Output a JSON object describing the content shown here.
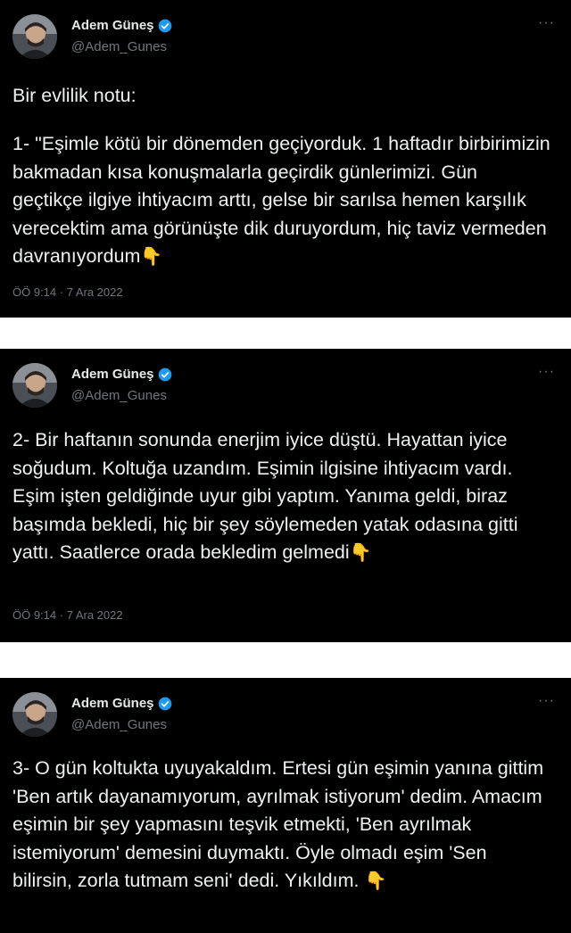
{
  "author": {
    "name": "Adem Güneş",
    "handle": "@Adem_Gunes"
  },
  "icons": {
    "verified": "verified-badge-icon",
    "more": "more-dots-icon",
    "emoji": "backhand-index-pointing-down-emoji"
  },
  "colors": {
    "background": "#000000",
    "text": "#e7e9ea",
    "secondary": "#71767b",
    "verified": "#1d9bf0",
    "emoji": "#f6c244"
  },
  "more_label": "···",
  "emoji_glyph": "👇",
  "tweets": [
    {
      "intro": "Bir evlilik notu:",
      "text": "1- \"Eşimle kötü bir dönemden geçiyorduk. 1 haftadır birbirimizin bakmadan kısa konuşmalarla geçirdik günlerimizi. Gün geçtikçe ilgiye ihtiyacım arttı, gelse bir sarılsa hemen karşılık verecektim ama görünüşte dik duruyordum, hiç taviz vermeden davranıyordum",
      "timestamp": "ÖÖ 9:14 · 7 Ara 2022"
    },
    {
      "text": "2- Bir haftanın sonunda enerjim iyice düştü. Hayattan iyice soğudum. Koltuğa uzandım. Eşimin ilgisine ihtiyacım vardı. Eşim işten geldiğinde uyur gibi yaptım. Yanıma geldi, biraz başımda bekledi, hiç bir şey söylemeden yatak odasına gitti yattı. Saatlerce orada bekledim gelmedi",
      "timestamp": "ÖÖ 9:14 · 7 Ara 2022"
    },
    {
      "text": "3- O gün koltukta uyuyakaldım. Ertesi gün eşimin yanına gittim 'Ben artık dayanamıyorum, ayrılmak istiyorum' dedim. Amacım eşimin bir şey yapmasını teşvik etmekti, 'Ben ayrılmak istemiyorum' demesini duymaktı. Öyle olmadı eşim 'Sen bilirsin, zorla tutmam seni' dedi. Yıkıldım."
    }
  ]
}
